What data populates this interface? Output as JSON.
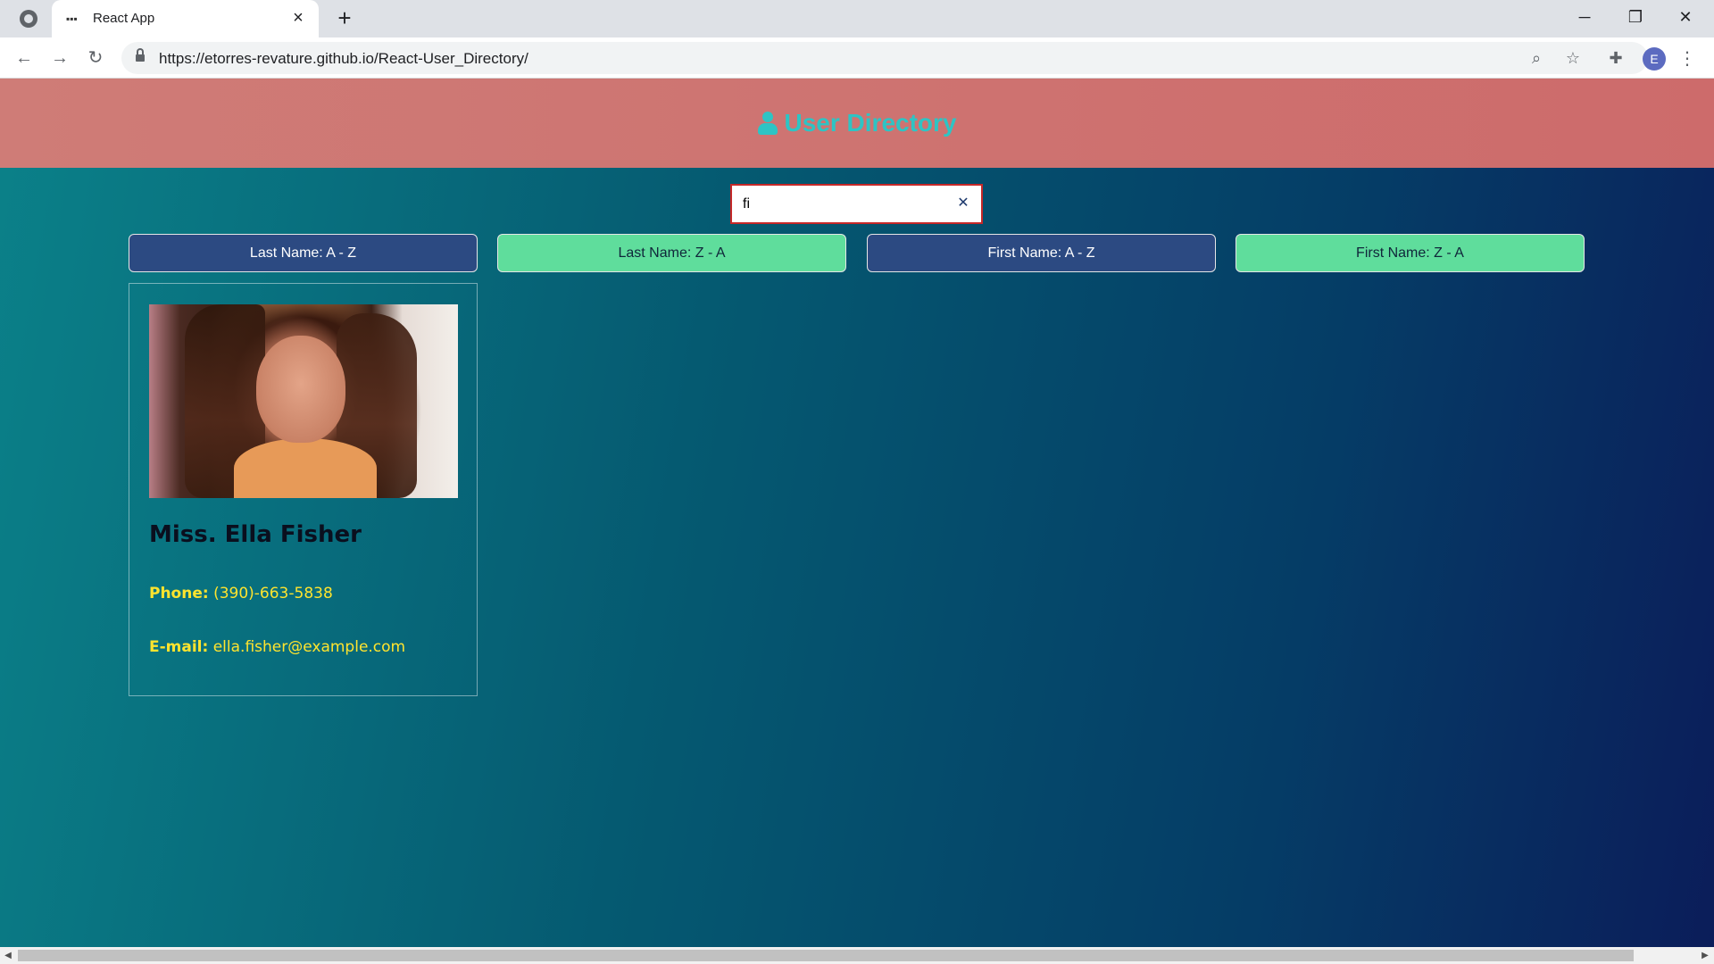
{
  "browser": {
    "tab_title": "React App",
    "url": "https://etorres-revature.github.io/React-User_Directory/",
    "avatar_letter": "E"
  },
  "app": {
    "title": "User Directory",
    "accent_color": "#2ec4c4",
    "header_color": "#cd7474"
  },
  "search": {
    "value": "fi"
  },
  "sort_buttons": [
    {
      "label": "Last Name: A - Z",
      "style": "dark"
    },
    {
      "label": "Last Name: Z - A",
      "style": "green"
    },
    {
      "label": "First Name: A - Z",
      "style": "dark"
    },
    {
      "label": "First Name: Z - A",
      "style": "green"
    }
  ],
  "users": [
    {
      "name": "Miss. Ella Fisher",
      "phone_label": "Phone:",
      "phone": "(390)-663-5838",
      "email_label": "E-mail:",
      "email": "ella.fisher@example.com"
    }
  ]
}
